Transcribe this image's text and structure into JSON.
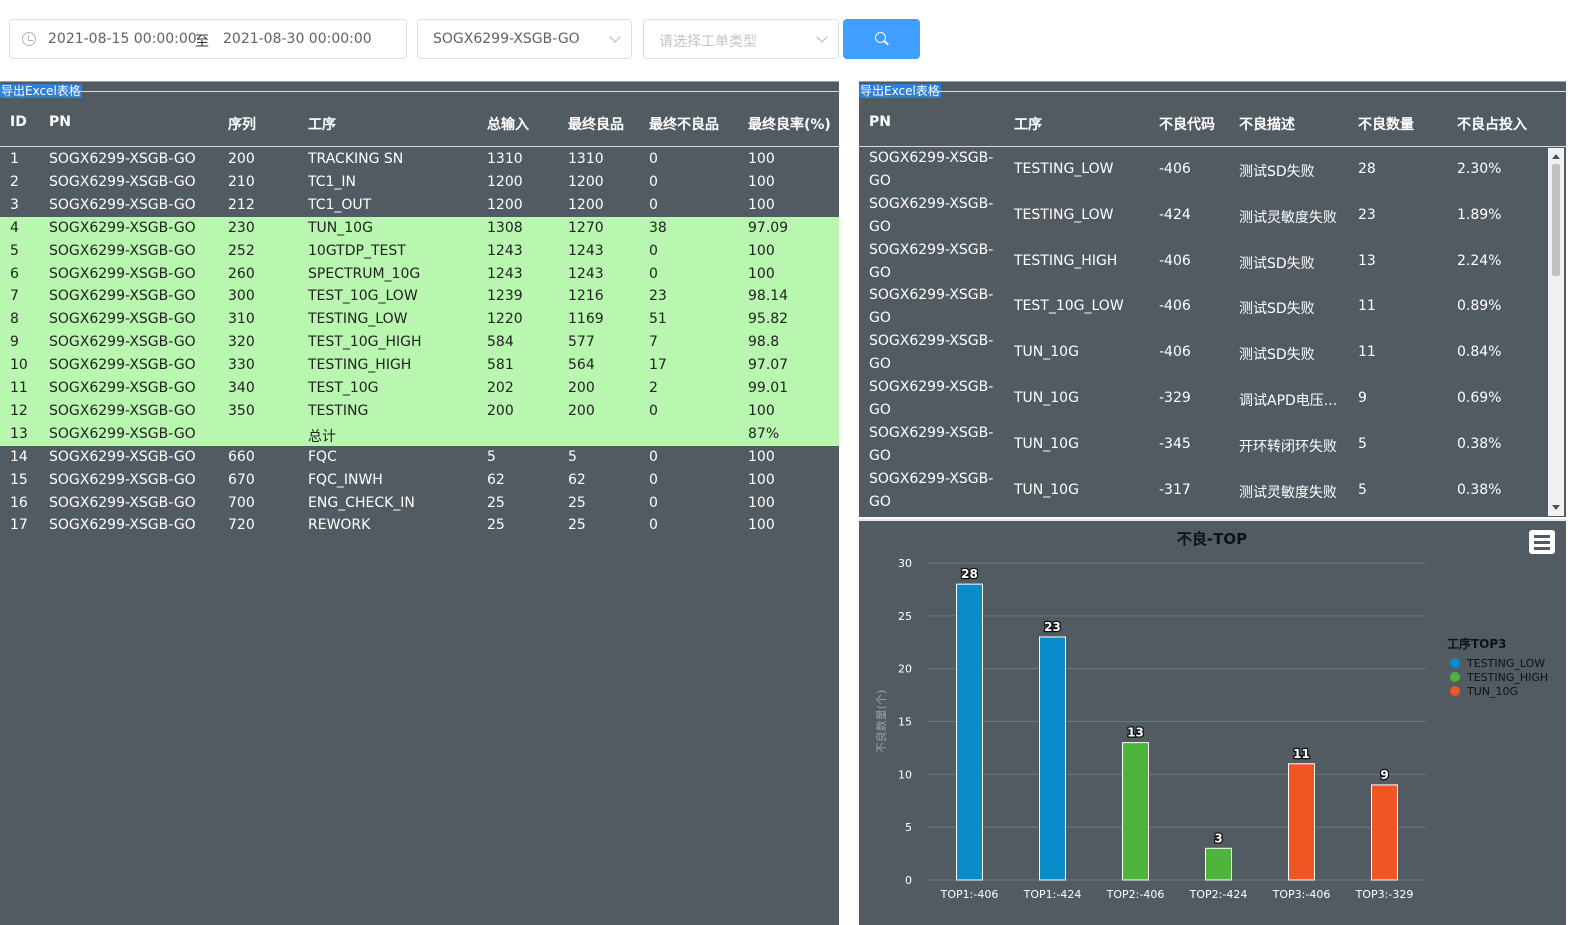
{
  "filters": {
    "date_start": "2021-08-15 00:00:00",
    "date_separator": "至",
    "date_end": "2021-08-30 00:00:00",
    "product_select": "SOGX6299-XSGB-GO",
    "order_type_placeholder": "请选择工单类型",
    "search_icon": "search-icon",
    "clock_icon": "clock-icon"
  },
  "left_table": {
    "export_label": "导出Excel表格",
    "headers": [
      "ID",
      "PN",
      "序列",
      "工序",
      "总输入",
      "最终良品",
      "最终不良品",
      "最终良率(%)"
    ],
    "highlight_color": "#b9f7b0",
    "rows": [
      {
        "id": "1",
        "pn": "SOGX6299-XSGB-GO",
        "seq": "200",
        "process": "TRACKING SN",
        "input": "1310",
        "good": "1310",
        "bad": "0",
        "yield": "100",
        "highlight": false
      },
      {
        "id": "2",
        "pn": "SOGX6299-XSGB-GO",
        "seq": "210",
        "process": "TC1_IN",
        "input": "1200",
        "good": "1200",
        "bad": "0",
        "yield": "100",
        "highlight": false
      },
      {
        "id": "3",
        "pn": "SOGX6299-XSGB-GO",
        "seq": "212",
        "process": "TC1_OUT",
        "input": "1200",
        "good": "1200",
        "bad": "0",
        "yield": "100",
        "highlight": false
      },
      {
        "id": "4",
        "pn": "SOGX6299-XSGB-GO",
        "seq": "230",
        "process": "TUN_10G",
        "input": "1308",
        "good": "1270",
        "bad": "38",
        "yield": "97.09",
        "highlight": true
      },
      {
        "id": "5",
        "pn": "SOGX6299-XSGB-GO",
        "seq": "252",
        "process": "10GTDP_TEST",
        "input": "1243",
        "good": "1243",
        "bad": "0",
        "yield": "100",
        "highlight": true
      },
      {
        "id": "6",
        "pn": "SOGX6299-XSGB-GO",
        "seq": "260",
        "process": "SPECTRUM_10G",
        "input": "1243",
        "good": "1243",
        "bad": "0",
        "yield": "100",
        "highlight": true
      },
      {
        "id": "7",
        "pn": "SOGX6299-XSGB-GO",
        "seq": "300",
        "process": "TEST_10G_LOW",
        "input": "1239",
        "good": "1216",
        "bad": "23",
        "yield": "98.14",
        "highlight": true
      },
      {
        "id": "8",
        "pn": "SOGX6299-XSGB-GO",
        "seq": "310",
        "process": "TESTING_LOW",
        "input": "1220",
        "good": "1169",
        "bad": "51",
        "yield": "95.82",
        "highlight": true
      },
      {
        "id": "9",
        "pn": "SOGX6299-XSGB-GO",
        "seq": "320",
        "process": "TEST_10G_HIGH",
        "input": "584",
        "good": "577",
        "bad": "7",
        "yield": "98.8",
        "highlight": true
      },
      {
        "id": "10",
        "pn": "SOGX6299-XSGB-GO",
        "seq": "330",
        "process": "TESTING_HIGH",
        "input": "581",
        "good": "564",
        "bad": "17",
        "yield": "97.07",
        "highlight": true
      },
      {
        "id": "11",
        "pn": "SOGX6299-XSGB-GO",
        "seq": "340",
        "process": "TEST_10G",
        "input": "202",
        "good": "200",
        "bad": "2",
        "yield": "99.01",
        "highlight": true
      },
      {
        "id": "12",
        "pn": "SOGX6299-XSGB-GO",
        "seq": "350",
        "process": "TESTING",
        "input": "200",
        "good": "200",
        "bad": "0",
        "yield": "100",
        "highlight": true
      },
      {
        "id": "13",
        "pn": "SOGX6299-XSGB-GO",
        "seq": "",
        "process": "总计",
        "input": "",
        "good": "",
        "bad": "",
        "yield": "87%",
        "highlight": true
      },
      {
        "id": "14",
        "pn": "SOGX6299-XSGB-GO",
        "seq": "660",
        "process": "FQC",
        "input": "5",
        "good": "5",
        "bad": "0",
        "yield": "100",
        "highlight": false
      },
      {
        "id": "15",
        "pn": "SOGX6299-XSGB-GO",
        "seq": "670",
        "process": "FQC_INWH",
        "input": "62",
        "good": "62",
        "bad": "0",
        "yield": "100",
        "highlight": false
      },
      {
        "id": "16",
        "pn": "SOGX6299-XSGB-GO",
        "seq": "700",
        "process": "ENG_CHECK_IN",
        "input": "25",
        "good": "25",
        "bad": "0",
        "yield": "100",
        "highlight": false
      },
      {
        "id": "17",
        "pn": "SOGX6299-XSGB-GO",
        "seq": "720",
        "process": "REWORK",
        "input": "25",
        "good": "25",
        "bad": "0",
        "yield": "100",
        "highlight": false
      }
    ]
  },
  "right_table": {
    "export_label": "导出Excel表格",
    "headers": [
      "PN",
      "工序",
      "不良代码",
      "不良描述",
      "不良数量",
      "不良占投入"
    ],
    "rows": [
      {
        "pn1": "SOGX6299-XSGB-",
        "pn2": "GO",
        "process": "TESTING_LOW",
        "code": "-406",
        "desc": "测试SD失败",
        "qty": "28",
        "ratio": "2.30%"
      },
      {
        "pn1": "SOGX6299-XSGB-",
        "pn2": "GO",
        "process": "TESTING_LOW",
        "code": "-424",
        "desc": "测试灵敏度失败",
        "qty": "23",
        "ratio": "1.89%"
      },
      {
        "pn1": "SOGX6299-XSGB-",
        "pn2": "GO",
        "process": "TESTING_HIGH",
        "code": "-406",
        "desc": "测试SD失败",
        "qty": "13",
        "ratio": "2.24%"
      },
      {
        "pn1": "SOGX6299-XSGB-",
        "pn2": "GO",
        "process": "TEST_10G_LOW",
        "code": "-406",
        "desc": "测试SD失败",
        "qty": "11",
        "ratio": "0.89%"
      },
      {
        "pn1": "SOGX6299-XSGB-",
        "pn2": "GO",
        "process": "TUN_10G",
        "code": "-406",
        "desc": "测试SD失败",
        "qty": "11",
        "ratio": "0.84%"
      },
      {
        "pn1": "SOGX6299-XSGB-",
        "pn2": "GO",
        "process": "TUN_10G",
        "code": "-329",
        "desc": "调试APD电压...",
        "qty": "9",
        "ratio": "0.69%"
      },
      {
        "pn1": "SOGX6299-XSGB-",
        "pn2": "GO",
        "process": "TUN_10G",
        "code": "-345",
        "desc": "开环转闭环失败",
        "qty": "5",
        "ratio": "0.38%"
      },
      {
        "pn1": "SOGX6299-XSGB-",
        "pn2": "GO",
        "process": "TUN_10G",
        "code": "-317",
        "desc": "测试灵敏度失败",
        "qty": "5",
        "ratio": "0.38%"
      }
    ]
  },
  "menu_icon": "menu-icon",
  "chart_data": {
    "type": "bar",
    "title": "不良-TOP",
    "ylabel": "不良数量(个)",
    "xlabel": "",
    "ylim": [
      0,
      30
    ],
    "yticks": [
      0,
      5,
      10,
      15,
      20,
      25,
      30
    ],
    "grid": true,
    "legend_title": "工序TOP3",
    "legend_position": "right",
    "categories": [
      "TOP1:-406",
      "TOP1:-424",
      "TOP2:-406",
      "TOP2:-424",
      "TOP3:-406",
      "TOP3:-329"
    ],
    "values": [
      28,
      23,
      13,
      3,
      11,
      9
    ],
    "bar_series": [
      0,
      0,
      1,
      1,
      2,
      2
    ],
    "series": [
      {
        "name": "TESTING_LOW",
        "color": "#0a8ccb"
      },
      {
        "name": "TESTING_HIGH",
        "color": "#4db33a"
      },
      {
        "name": "TUN_10G",
        "color": "#ef5623"
      }
    ]
  }
}
